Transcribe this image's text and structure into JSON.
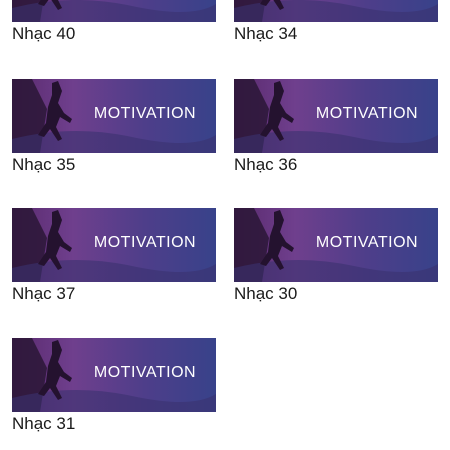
{
  "items": [
    {
      "name": "Nhạc 40",
      "banner_text": ""
    },
    {
      "name": "Nhạc 34",
      "banner_text": ""
    },
    {
      "name": "Nhạc 35",
      "banner_text": "MOTIVATION"
    },
    {
      "name": "Nhạc 36",
      "banner_text": "MOTIVATION"
    },
    {
      "name": "Nhạc 37",
      "banner_text": "MOTIVATION"
    },
    {
      "name": "Nhạc 30",
      "banner_text": "MOTIVATION"
    },
    {
      "name": "Nhạc 31",
      "banner_text": "MOTIVATION"
    }
  ],
  "colors": {
    "banner_start": "#5a2a6e",
    "banner_end": "#38428a",
    "label_text": "#1a1a1a"
  },
  "icons": {
    "banner_figure": "climber-silhouette-icon"
  }
}
